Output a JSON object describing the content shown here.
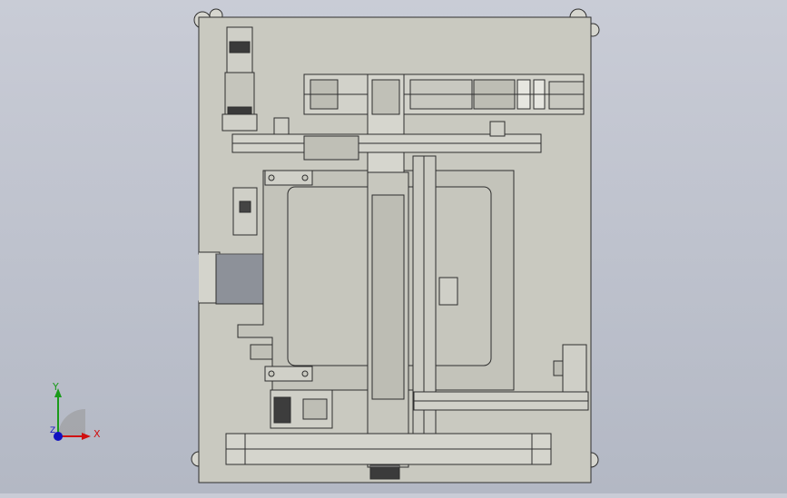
{
  "viewport": {
    "background_top": "#c9ccd6",
    "background_bottom": "#b3b8c4",
    "part_fill": "#c7c7be",
    "edge_color": "#2e2e2e"
  },
  "triad": {
    "x_label": "X",
    "y_label": "Y",
    "z_label": "Z",
    "x_color": "#d01010",
    "y_color": "#1a9a1a",
    "z_color": "#1010c0"
  }
}
